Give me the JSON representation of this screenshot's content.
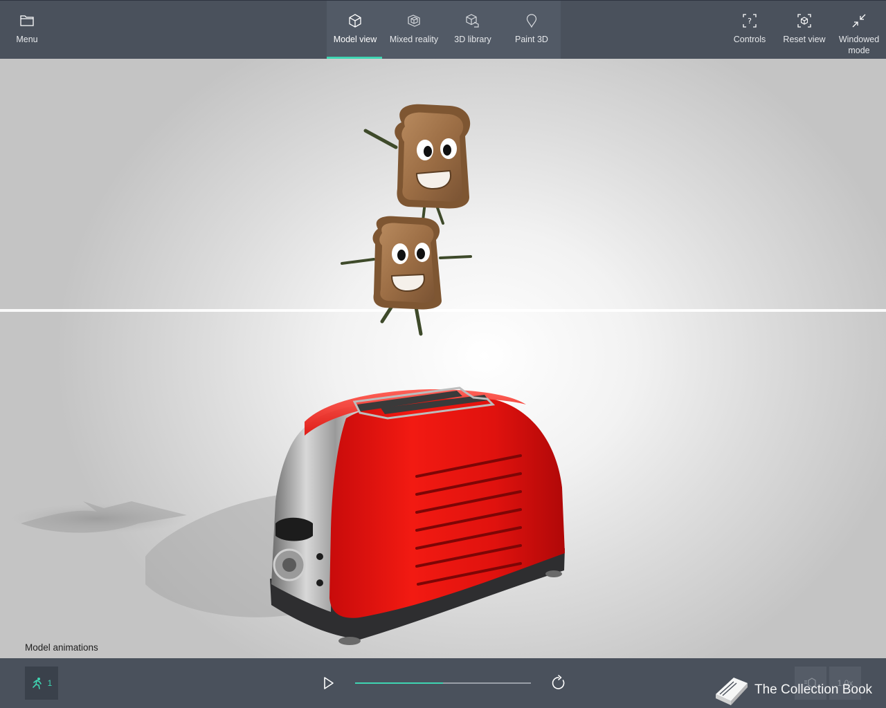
{
  "topbar": {
    "menu_label": "Menu",
    "tabs": [
      {
        "label": "Model view",
        "icon": "cube-icon",
        "active": true
      },
      {
        "label": "Mixed reality",
        "icon": "mixed-reality-icon",
        "active": false
      },
      {
        "label": "3D library",
        "icon": "3d-library-icon",
        "active": false
      },
      {
        "label": "Paint 3D",
        "icon": "paint-3d-icon",
        "active": false
      }
    ],
    "controls_label": "Controls",
    "reset_view_label": "Reset view",
    "windowed_mode_label": "Windowed mode",
    "accent_color": "#3fd6b3"
  },
  "viewport": {
    "animations_caption": "Model animations"
  },
  "bottombar": {
    "animation_count": "1",
    "progress": 0.5,
    "speed_label": "1.0x",
    "watermark_text": "The Collection Book"
  }
}
